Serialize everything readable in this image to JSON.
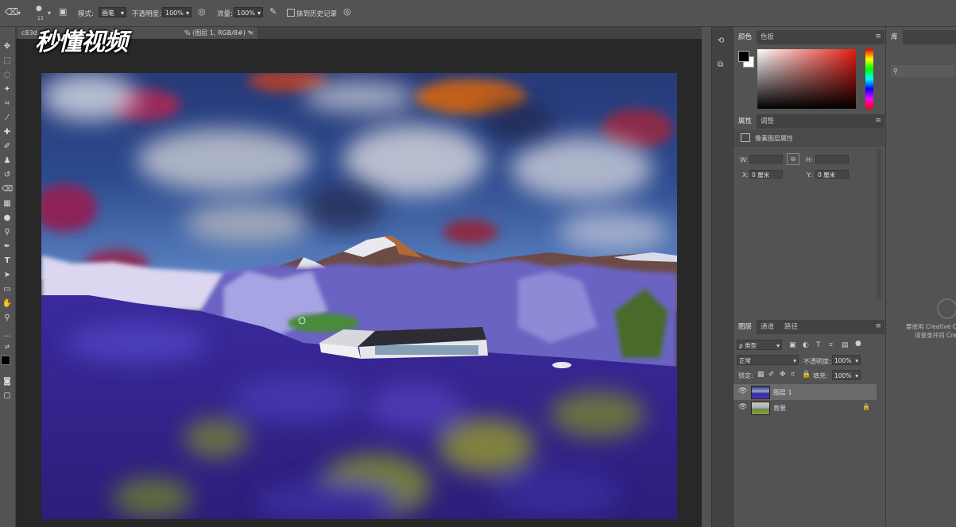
{
  "options_bar": {
    "brush_size": "13",
    "mode_label": "模式:",
    "mode_value": "画笔",
    "opacity_label": "不透明度:",
    "opacity_value": "100%",
    "flow_label": "流量:",
    "flow_value": "100%",
    "history_label": "抹到历史记录"
  },
  "document": {
    "tab_prefix": "c83d",
    "tab_middle": "4bfa1cd11",
    "tab_suffix": "% (图层 1, RGB/8#) *",
    "close": "×"
  },
  "watermark": "秒懂视频",
  "color_panel": {
    "tabs": [
      "颜色",
      "色板"
    ],
    "menu_icon": "menu-icon"
  },
  "library_panel": {
    "tab": "库",
    "cc_line1": "要使用 Creative Clo",
    "cc_line2": "请登录并同 Creat"
  },
  "properties_panel": {
    "tabs": [
      "属性",
      "调整"
    ],
    "title": "像素图层属性",
    "w_label": "W:",
    "h_label": "H:",
    "x_label": "X:",
    "x_value": "0 厘米",
    "y_label": "Y:",
    "y_value": "0 厘米"
  },
  "layers_panel": {
    "tabs": [
      "图层",
      "通道",
      "路径"
    ],
    "filter_label": "ρ 类型",
    "blend_mode": "正常",
    "opacity_label": "不透明度:",
    "opacity_value": "100%",
    "lock_label": "锁定:",
    "fill_label": "填充:",
    "fill_value": "100%",
    "layers": [
      {
        "name": "图层 1",
        "selected": true
      },
      {
        "name": "背景",
        "selected": false,
        "locked": true
      }
    ]
  },
  "colors": {
    "panel_bg": "#535353",
    "canvas_bg": "#282828",
    "selected_layer": "#6a6a6a"
  }
}
